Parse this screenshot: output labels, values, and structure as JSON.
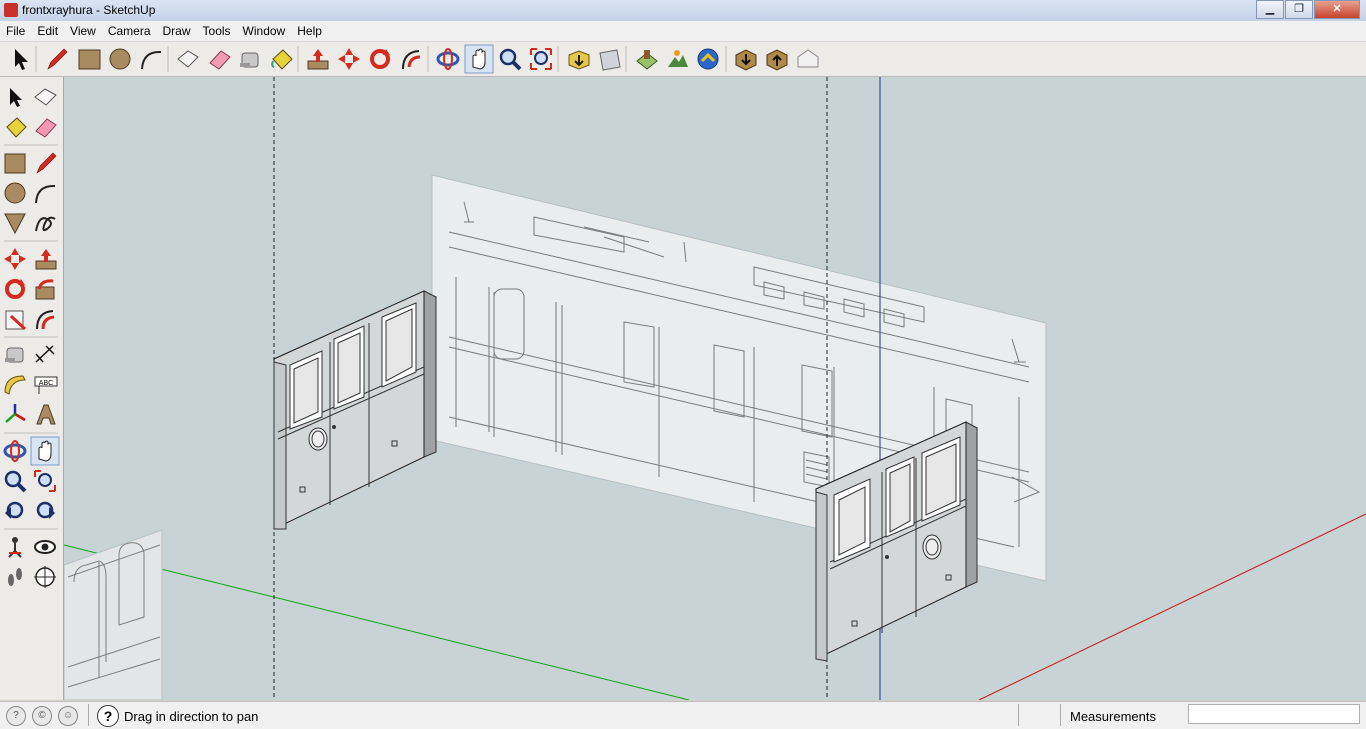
{
  "window": {
    "title": "frontxrayhura - SketchUp",
    "min": "▁",
    "max": "❐",
    "close": "✕"
  },
  "menu": [
    {
      "label": "File"
    },
    {
      "label": "Edit"
    },
    {
      "label": "View"
    },
    {
      "label": "Camera"
    },
    {
      "label": "Draw"
    },
    {
      "label": "Tools"
    },
    {
      "label": "Window"
    },
    {
      "label": "Help"
    }
  ],
  "toolbar_top": [
    "select-icon",
    "pencil-icon",
    "rectangle-icon",
    "circle-icon",
    "arc-icon",
    "make-component-icon",
    "eraser-icon",
    "tape-measure-icon",
    "paint-bucket-icon",
    "push-pull-icon",
    "move-icon",
    "rotate-icon",
    "follow-me-icon",
    "orbit-icon",
    "pan-icon",
    "zoom-icon",
    "zoom-extents-icon",
    "get-models-icon",
    "share-model-icon",
    "add-location-icon",
    "toggle-terrain-icon",
    "preview-google-earth-icon",
    "get-components-icon",
    "share-component-icon",
    "extension-warehouse-icon"
  ],
  "toolbar_left": [
    "select-icon",
    "make-component-icon",
    "paint-bucket-icon",
    "eraser-icon",
    "rectangle-icon",
    "line-icon",
    "circle-icon",
    "arc-icon",
    "polygon-icon",
    "freehand-icon",
    "move-icon",
    "push-pull-icon",
    "rotate-icon",
    "follow-me-icon",
    "scale-icon",
    "offset-icon",
    "tape-measure-icon",
    "dimensions-icon",
    "protractor-icon",
    "text-icon",
    "axes-icon",
    "3d-text-icon",
    "orbit-icon",
    "pan-icon",
    "zoom-icon",
    "zoom-window-icon",
    "previous-view-icon",
    "next-view-icon",
    "position-camera-icon",
    "look-around-icon",
    "walk-icon",
    "section-plane-icon"
  ],
  "status": {
    "hint": "Drag in direction to pan",
    "help_symbol": "?",
    "measurements_label": "Measurements",
    "measurements_value": ""
  },
  "colors": {
    "viewport_bg": "#c7d3d4",
    "axis_green": "#11a31a",
    "axis_red": "#c81414",
    "axis_blue": "#1c2fa8"
  }
}
